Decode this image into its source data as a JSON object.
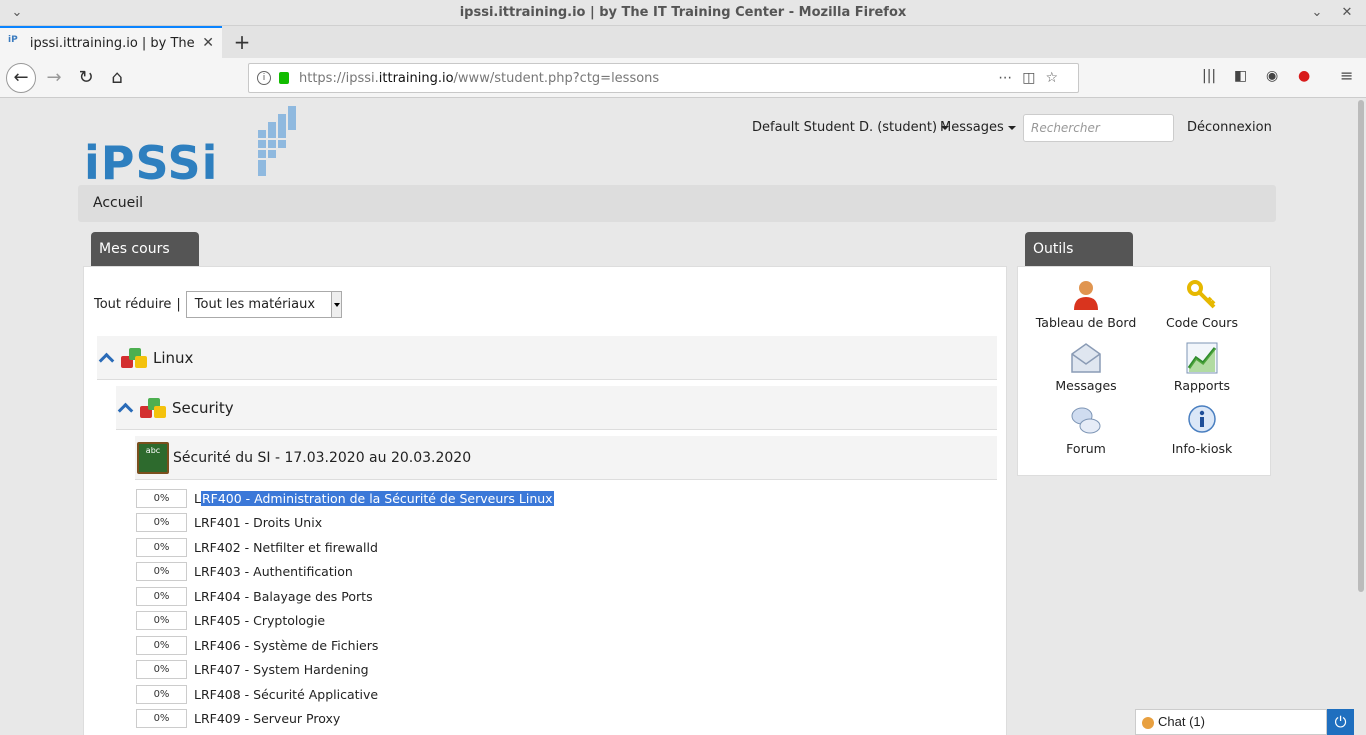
{
  "window": {
    "title": "ipssi.ittraining.io | by The IT Training Center - Mozilla Firefox"
  },
  "tab": {
    "title": "ipssi.ittraining.io | by The IT Training Center"
  },
  "urlbar": {
    "url_prefix": "https://ipssi.",
    "url_domain": "ittraining.io",
    "url_path": "/www/student.php?ctg=lessons"
  },
  "header": {
    "logo_text": "iPSSi",
    "user_menu_label": "Default Student D. (student)",
    "messages_label": "Messages",
    "search_placeholder": "Rechercher",
    "logout_label": "Déconnexion"
  },
  "breadcrumb": {
    "label": "Accueil"
  },
  "courses": {
    "tab_label": "Mes cours",
    "collapse_label": "Tout réduire",
    "separator": "|",
    "material_select": "Tout les matériaux",
    "categories": [
      {
        "label": "Linux"
      },
      {
        "label": "Security"
      }
    ],
    "course": {
      "title": "Sécurité du SI - 17.03.2020 au 20.03.2020"
    },
    "lessons": [
      {
        "progress": "0%",
        "prefix": "L",
        "selected": "RF400 - Administration de la Sécurité de Serveurs Linux"
      },
      {
        "progress": "0%",
        "label": "LRF401 - Droits Unix"
      },
      {
        "progress": "0%",
        "label": "LRF402 - Netfilter et firewalld"
      },
      {
        "progress": "0%",
        "label": "LRF403 - Authentification"
      },
      {
        "progress": "0%",
        "label": "LRF404 - Balayage des Ports"
      },
      {
        "progress": "0%",
        "label": "LRF405 - Cryptologie"
      },
      {
        "progress": "0%",
        "label": "LRF406 - Système de Fichiers"
      },
      {
        "progress": "0%",
        "label": "LRF407 - System Hardening"
      },
      {
        "progress": "0%",
        "label": "LRF408 - Sécurité Applicative"
      },
      {
        "progress": "0%",
        "label": "LRF409 - Serveur Proxy"
      }
    ]
  },
  "tools": {
    "tab_label": "Outils",
    "items": [
      {
        "label": "Tableau de Bord",
        "icon": "user-icon"
      },
      {
        "label": "Code Cours",
        "icon": "key-icon"
      },
      {
        "label": "Messages",
        "icon": "envelope-icon"
      },
      {
        "label": "Rapports",
        "icon": "chart-icon"
      },
      {
        "label": "Forum",
        "icon": "speech-bubbles-icon"
      },
      {
        "label": "Info-kiosk",
        "icon": "info-icon"
      }
    ]
  },
  "chat": {
    "label": "Chat (1)"
  },
  "colors": {
    "accent": "#2e7fbf",
    "selection": "#3b78d8",
    "panel_tab": "#555555"
  }
}
